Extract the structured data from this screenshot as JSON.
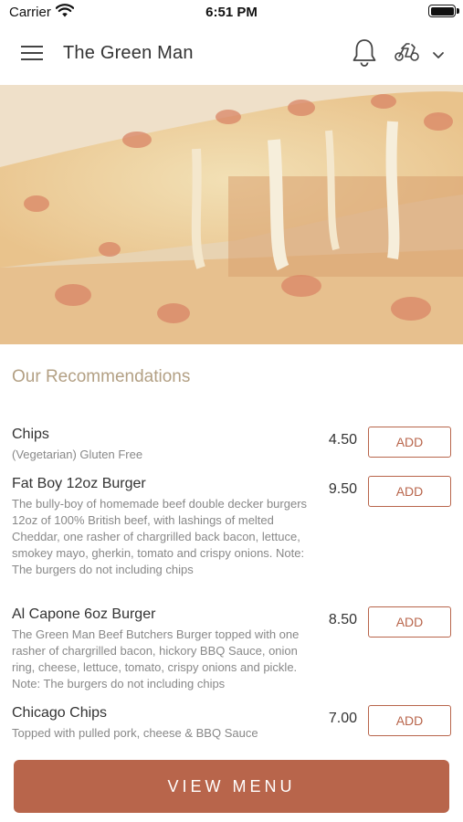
{
  "status_bar": {
    "carrier": "Carrier",
    "time": "6:51 PM",
    "wifi_icon": "wifi-icon",
    "battery_icon": "battery-icon"
  },
  "header": {
    "title": "The Green Man",
    "menu_icon": "hamburger-menu-icon",
    "notification_icon": "bell-icon",
    "delivery_icon": "scooter-icon",
    "dropdown_icon": "chevron-down-icon"
  },
  "hero": {
    "image": "pizza-cheese-pull-photo"
  },
  "recommendations": {
    "heading": "Our Recommendations",
    "items": [
      {
        "name": "Chips",
        "description": "(Vegetarian) Gluten Free",
        "price": "4.50",
        "button_label": "ADD"
      },
      {
        "name": "Fat Boy 12oz Burger",
        "description": "The bully-boy of homemade beef double decker burgers 12oz of 100% British beef, with lashings of melted Cheddar, one rasher of chargrilled back bacon,  lettuce, smokey mayo, gherkin, tomato and crispy onions.  Note: The burgers do not including chips",
        "price": "9.50",
        "button_label": "ADD"
      },
      {
        "name": "Al Capone 6oz Burger",
        "description": "The Green Man Beef Butchers Burger topped with one rasher of chargrilled bacon, hickory BBQ Sauce, onion ring,  cheese, lettuce, tomato, crispy onions and pickle. Note: The burgers do not including chips",
        "price": "8.50",
        "button_label": "ADD"
      },
      {
        "name": "Chicago Chips",
        "description": "Topped with pulled pork, cheese & BBQ Sauce",
        "price": "7.00",
        "button_label": "ADD"
      }
    ]
  },
  "footer": {
    "view_menu_label": "VIEW MENU"
  },
  "colors": {
    "accent": "#b8654b",
    "heading": "#b3a084",
    "text": "#333333",
    "muted": "#888888"
  }
}
